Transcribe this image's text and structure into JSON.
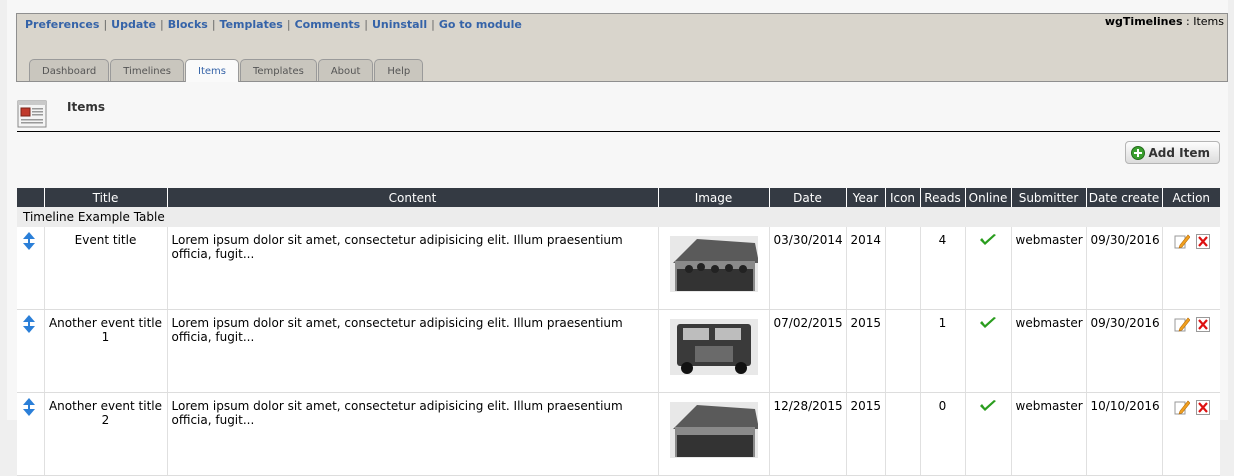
{
  "nav": {
    "links": [
      "Preferences",
      "Update",
      "Blocks",
      "Templates",
      "Comments",
      "Uninstall",
      "Go to module"
    ],
    "module_name": "wgTimelines",
    "module_sep": " : ",
    "module_page": "Items",
    "tabs": [
      "Dashboard",
      "Timelines",
      "Items",
      "Templates",
      "About",
      "Help"
    ],
    "active_tab": "Items"
  },
  "page": {
    "title": "Items",
    "add_button": "Add Item"
  },
  "table": {
    "headers": [
      "",
      "Title",
      "Content",
      "Image",
      "Date",
      "Year",
      "Icon",
      "Reads",
      "Online",
      "Submitter",
      "Date create",
      "Action"
    ],
    "caption": "Timeline Example Table",
    "rows": [
      {
        "title": "Event title",
        "content": "Lorem ipsum dolor sit amet, consectetur adipisicing elit. Illum praesentium officia, fugit...",
        "date": "03/30/2014",
        "year": "2014",
        "icon": "",
        "reads": "4",
        "online": "check-icon",
        "submitter": "webmaster",
        "date_create": "09/30/2016"
      },
      {
        "title": "Another event title 1",
        "content": "Lorem ipsum dolor sit amet, consectetur adipisicing elit. Illum praesentium officia, fugit...",
        "date": "07/02/2015",
        "year": "2015",
        "icon": "",
        "reads": "1",
        "online": "check-icon",
        "submitter": "webmaster",
        "date_create": "09/30/2016"
      },
      {
        "title": "Another event title 2",
        "content": "Lorem ipsum dolor sit amet, consectetur adipisicing elit. Illum praesentium officia, fugit...",
        "date": "12/28/2015",
        "year": "2015",
        "icon": "",
        "reads": "0",
        "online": "check-icon",
        "submitter": "webmaster",
        "date_create": "10/10/2016"
      }
    ]
  },
  "colors": {
    "link": "#3563a8",
    "header_bg": "#343a43",
    "admin_box": "#d9d5cc",
    "check": "#2a9d1e"
  }
}
